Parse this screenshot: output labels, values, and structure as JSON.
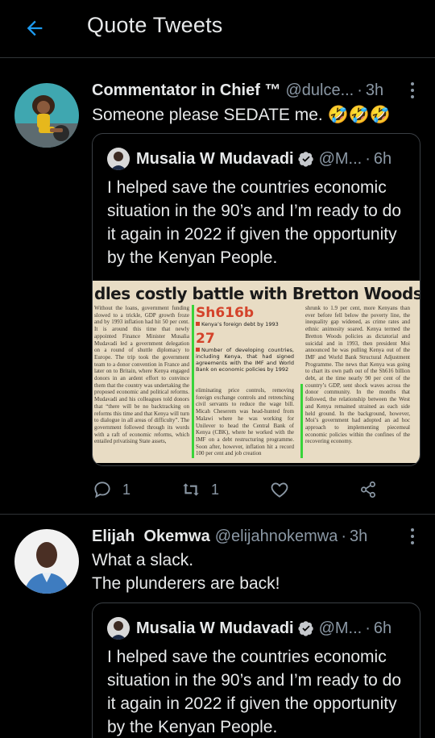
{
  "header": {
    "title": "Quote Tweets"
  },
  "tweets": [
    {
      "author": "Commentator in Chief ™",
      "handle": "@dulce...",
      "sep": "·",
      "time": "3h",
      "text": "Someone please SEDATE me. 🤣🤣🤣",
      "quote": {
        "author": "Musalia W Mudavadi",
        "handle": "@M...",
        "sep": "·",
        "time": "6h",
        "text": "I helped save the countries economic situation in the 90’s and I’m ready to do it again in 2022 if given the opportunity by the Kenyan People.",
        "image": {
          "headline": "dles costly battle with Bretton Woods ins",
          "col1": "Without the loans, government funding slowed to a trickle, GDP growth froze and by 1993 inflation had hit 50 per cent. It is around this time that newly appointed Finance Minister Musalia Mudavadi led a government delegation on a round of shuttle diplomacy to Europe. The trip took the government team to a donor convention in France and later on to Britain, where Kenya engaged donors in an ardent effort to convince them that the country was undertaking the proposed economic and political reforms. Mudavadi and his colleagues told donors that “there will be no backtracking on reforms this time and that Kenya will turn to dialogue in all areas of difficulty”. The government followed through its words with a raft of economic reforms, which entailed privatising State assets,",
          "stat1_value": "Sh616b",
          "stat1_label": "Kenya’s foreign debt by 1993",
          "stat2_value": "27",
          "stat2_label": "Number of developing countries, including Kenya, that had signed agreements with the IMF and World Bank on economic policies by 1992",
          "col2": "eliminating price controls, removing foreign exchange controls and retrenching civil servants to reduce the wage bill. Micah Cheserem was head-hunted from Malawi where he was working for Unilever to head the Central Bank of Kenya (CBK), where he worked with the IMF on a debt restructuring programme. Soon after, however, inflation hit a record 100 per cent and job creation",
          "col3": "shrunk to 1.9 per cent, more Kenyans than ever before fell below the poverty line, the inequality gap widened, as crime rates and ethnic animosity soared. Kenya termed the Bretton Woods policies as dictatorial and suicidal and in 1993, then president Moi announced he was pulling Kenya out of the IMF and World Bank Structural Adjustment Programme. The news that Kenya was going to chart its own path out of the Sh616 billion debt, at the time nearly 90 per cent of the country’s GDP, sent shock waves across the donor community. In the months that followed, the relationship between the West and Kenya remained strained as each side held ground. In the background, however, Moi’s government had adopted an ad hoc approach to implementing piecemeal economic policies within the confines of the recovering economy."
        }
      },
      "replies": "1",
      "retweets": "1"
    },
    {
      "author": "Elijah  Okemwa",
      "handle": "@elijahnokemwa",
      "sep": "·",
      "time": "3h",
      "text_line1": "What a slack.",
      "text_line2": "The plunderers are back!",
      "quote": {
        "author": "Musalia W Mudavadi",
        "handle": "@M...",
        "sep": "·",
        "time": "6h",
        "text": "I helped save the countries economic situation in the 90’s and I’m ready to do it again in 2022 if given the opportunity by the Kenyan People."
      }
    }
  ],
  "icons": {
    "back": "arrow-left-icon",
    "more": "more-vertical-icon",
    "verified": "verified-badge-icon",
    "reply": "reply-icon",
    "retweet": "retweet-icon",
    "like": "heart-icon",
    "share": "share-icon"
  },
  "colors": {
    "accent": "#1d9bf0",
    "background": "#000000",
    "muted": "#8b98a5"
  }
}
